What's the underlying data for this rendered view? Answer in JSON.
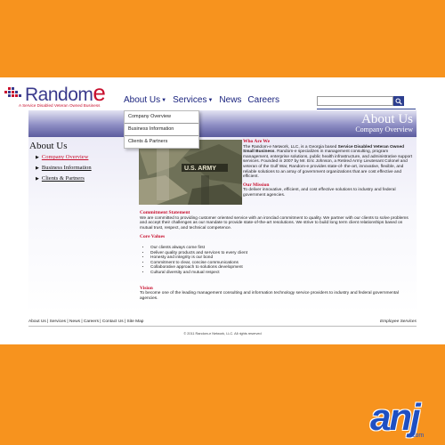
{
  "logo": {
    "name": "Random",
    "name_tail": "e",
    "tagline": "A Service Disabled Veteran Owned Business"
  },
  "nav": [
    {
      "label": "About Us",
      "has_menu": true
    },
    {
      "label": "Services",
      "has_menu": true
    },
    {
      "label": "News",
      "has_menu": false
    },
    {
      "label": "Careers",
      "has_menu": false
    }
  ],
  "search": {
    "placeholder": "",
    "button_icon": "search-icon"
  },
  "dropdown": [
    "Company Overview",
    "Business Information",
    "Clients & Partners"
  ],
  "banner": {
    "title": "About Us",
    "subtitle": "Company Overview"
  },
  "sidebar": {
    "title": "About Us",
    "items": [
      {
        "label": "Company Overview",
        "active": true
      },
      {
        "label": "Business Information",
        "active": false
      },
      {
        "label": "Clients & Partners",
        "active": false
      }
    ]
  },
  "photo": {
    "patch_text": "U.S. ARMY"
  },
  "main": {
    "who_title": "Who Are We",
    "who_intro": "The Random-e Network, LLC, is a Georgia based ",
    "who_bold": "Service Disabled Veteran Owned Small Business",
    "who_rest": ". Random-e specializes in management consulting, program management, enterprise solutions, public health infrastructure, and administrative support services. Founded in 2007 by Mr. Eric Johnson, a Retired Army Lieutenant Colonel and veteran of the Gulf War, Random-e provides state-of- the-art, innovative, flexible, and reliable solutions to an array of government organizations that are cost effective and efficient.",
    "mission_title": "Our Mission",
    "mission_text": "To deliver innovative, efficient, and cost effective solutions to industry and federal government agencies.",
    "commitment_title": "Commitment Statement",
    "commitment_text": "We are committed to providing customer oriented service with an ironclad commitment to quality. We partner with our clients to solve problems and accept their challenges as our mandate to provide state-of-the-art resolutions. We strive to build long term client relationships based on mutual trust, respect, and technical competence.",
    "values_title": "Core Values",
    "values": [
      "Our clients always come first",
      "Deliver quality products and services to every client",
      "Honesty and integrity is our bond",
      "Commitment to clear, concise communications",
      "Collaborative approach to solutions development",
      "Cultural diversity and mutual respect"
    ],
    "vision_title": "Vision",
    "vision_text": "To become one of the leading management consulting and information technology service providers to industry and federal governmental agencies."
  },
  "footer": {
    "links": [
      "About Us",
      "Services",
      "News",
      "Careers",
      "Contact Us",
      "Site Map"
    ],
    "separator": " | ",
    "right": "Employee Services",
    "copyright": "© 2011 Random-e Network, LLC. All rights reserved"
  },
  "badge": {
    "text": "anj",
    "sub": ".com"
  },
  "colors": {
    "background": "#f7931e",
    "brand_blue": "#3a3a8c",
    "brand_red": "#c8102e",
    "nav_text": "#1a237e",
    "badge_blue": "#1e4fc2"
  }
}
